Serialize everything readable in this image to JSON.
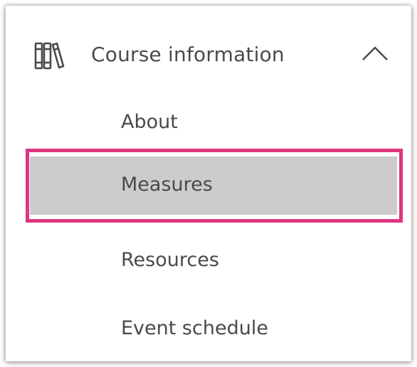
{
  "section": {
    "title": "Course information",
    "icon": "books-icon",
    "expanded": true
  },
  "items": [
    {
      "label": "About"
    },
    {
      "label": "Measures",
      "selected": true
    },
    {
      "label": "Resources"
    },
    {
      "label": "Event schedule"
    }
  ],
  "colors": {
    "selected_background": "#cccccc",
    "highlight_border": "#e0357f",
    "text": "#4a4a4a"
  }
}
